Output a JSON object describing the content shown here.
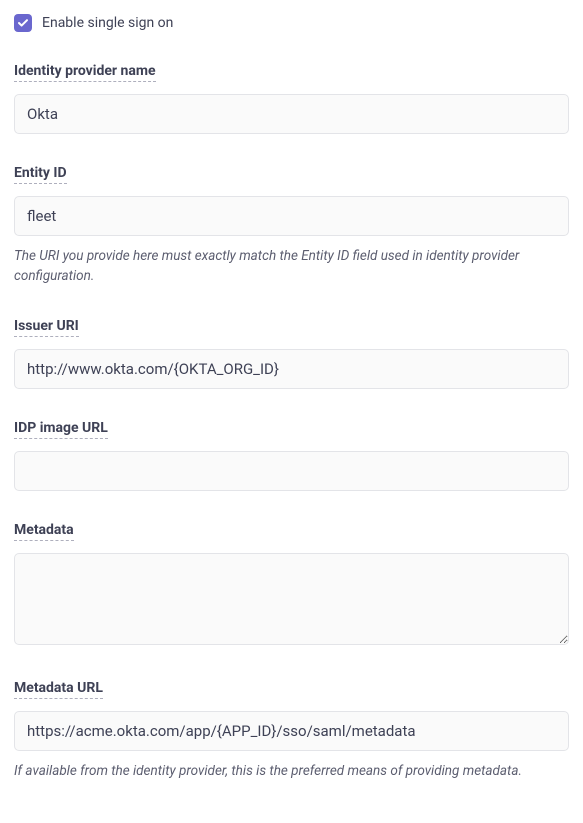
{
  "enable_sso": {
    "label": "Enable single sign on",
    "checked": true
  },
  "fields": {
    "idp_name": {
      "label": "Identity provider name",
      "value": "Okta"
    },
    "entity_id": {
      "label": "Entity ID",
      "value": "fleet",
      "help": "The URI you provide here must exactly match the Entity ID field used in identity provider configuration."
    },
    "issuer_uri": {
      "label": "Issuer URI",
      "value": "http://www.okta.com/{OKTA_ORG_ID}"
    },
    "idp_image_url": {
      "label": "IDP image URL",
      "value": ""
    },
    "metadata": {
      "label": "Metadata",
      "value": ""
    },
    "metadata_url": {
      "label": "Metadata URL",
      "value": "https://acme.okta.com/app/{APP_ID}/sso/saml/metadata",
      "help": "If available from the identity provider, this is the preferred means of providing metadata."
    }
  }
}
